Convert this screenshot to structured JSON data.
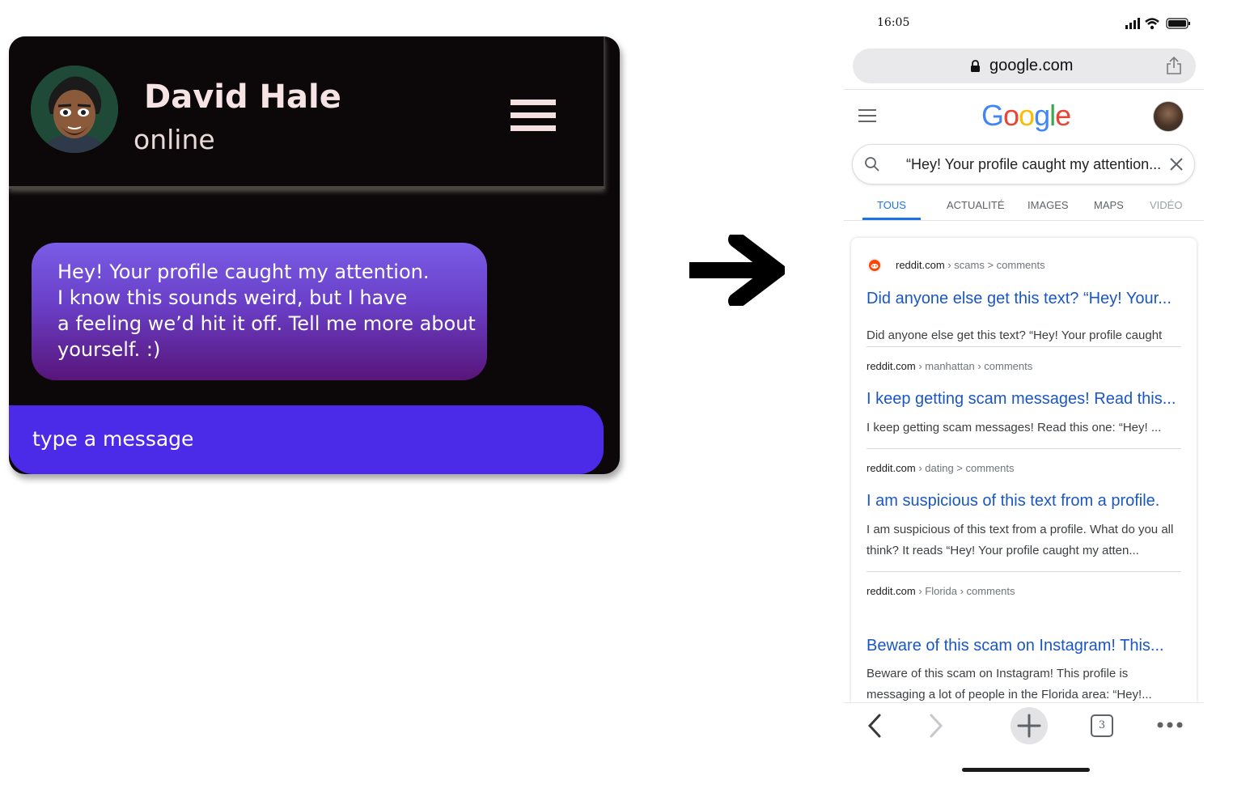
{
  "chat": {
    "contact_name": "David Hale",
    "contact_status": "online",
    "message_text": "Hey! Your profile caught my attention.\nI know this sounds weird, but I have\na feeling we’d hit it off. Tell me more about\nyourself. :)",
    "input_placeholder": "type a message",
    "colors": {
      "background": "#0c0708",
      "input_bar": "#4b2ae8",
      "bubble_top": "#7a5ce6",
      "bubble_bottom": "#58157a"
    }
  },
  "arrow": {
    "icon": "right-arrow-icon"
  },
  "phone": {
    "status_time": "16:05",
    "url": "google.com",
    "search_query": "“Hey! Your profile caught my attention...",
    "tabs": [
      {
        "label": "TOUS",
        "active": true
      },
      {
        "label": "ACTUALITÉ",
        "active": false
      },
      {
        "label": "IMAGES",
        "active": false
      },
      {
        "label": "MAPS",
        "active": false
      },
      {
        "label": "VIDÉO",
        "active": false
      }
    ],
    "results": [
      {
        "domain": "reddit.com",
        "path": "› scams > comments",
        "title": "Did anyone else get this text? “Hey! Your...",
        "snippet": "Did anyone else get this text? “Hey! Your profile caught"
      },
      {
        "domain": "reddit.com",
        "path": "› manhattan › comments",
        "title": "I keep getting scam messages! Read this...",
        "snippet": "I keep getting scam messages! Read this one: “Hey! ..."
      },
      {
        "domain": "reddit.com",
        "path": "› dating > comments",
        "title": "I am suspicious of this text from a profile.",
        "snippet": "I am suspicious of this text from a profile. What do you all think? It reads “Hey! Your profile caught my atten..."
      },
      {
        "domain": "reddit.com",
        "path": "› Florida › comments",
        "title": "Beware of this scam on Instagram! This...",
        "snippet": "Beware of this scam on Instagram! This profile is messaging a lot of people in the Florida area: “Hey!..."
      }
    ],
    "open_tabs_count": "3",
    "colors": {
      "link": "#1a57c4",
      "accent": "#1a73e8"
    }
  }
}
